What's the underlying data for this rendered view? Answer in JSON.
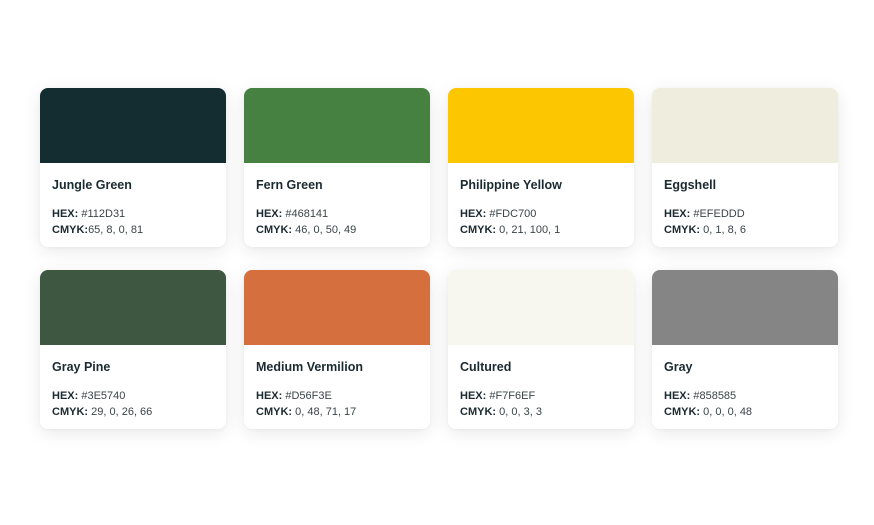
{
  "hex_label": "HEX:",
  "cmyk_label": "CMYK:",
  "cards": [
    {
      "name": "Jungle Green",
      "hex": "#112D31",
      "cmyk": "65, 8, 0, 81",
      "color": "#132D31"
    },
    {
      "name": "Fern Green",
      "hex": "#468141",
      "cmyk": "46, 0, 50, 49",
      "color": "#468141"
    },
    {
      "name": "Philippine Yellow",
      "hex": "#FDC700",
      "cmyk": "0, 21, 100, 1",
      "color": "#FDC700"
    },
    {
      "name": "Eggshell",
      "hex": "#EFEDDD",
      "cmyk": "0, 1, 8, 6",
      "color": "#EFEDDD"
    },
    {
      "name": "Gray Pine",
      "hex": "#3E5740",
      "cmyk": "29, 0, 26, 66",
      "color": "#3E5740"
    },
    {
      "name": "Medium Vermilion",
      "hex": "#D56F3E",
      "cmyk": "0, 48, 71, 17",
      "color": "#D56F3E"
    },
    {
      "name": "Cultured",
      "hex": "#F7F6EF",
      "cmyk": "0, 0, 3, 3",
      "color": "#F7F6EF"
    },
    {
      "name": "Gray",
      "hex": "#858585",
      "cmyk": "0, 0, 0, 48",
      "color": "#858585"
    }
  ]
}
